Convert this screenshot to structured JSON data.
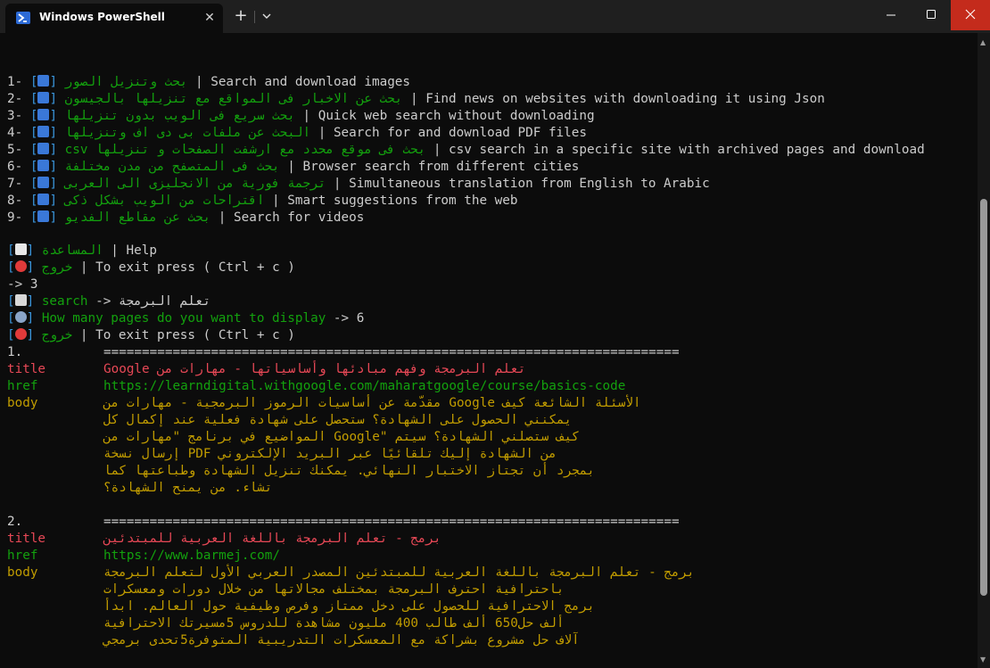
{
  "window": {
    "tab_title": "Windows PowerShell",
    "close_tab": "✕",
    "new_tab": "+"
  },
  "menu": [
    {
      "num": "1-",
      "ar": "بحث وتنزيل الصور",
      "en": "Search and download images"
    },
    {
      "num": "2-",
      "ar": "بحث عن الاخبار فى المواقع مع تنزيلها بالجيسون",
      "en": "Find news on websites with downloading it using Json"
    },
    {
      "num": "3-",
      "ar": "بحث سريع فى الويب بدون تنزيلها",
      "en": "Quick web search without downloading"
    },
    {
      "num": "4-",
      "ar": "البحث عن ملفات بى دى اف وتنزيلها",
      "en": "Search for and download PDF files"
    },
    {
      "num": "5-",
      "ar": "بحث فى موقع محدد مع ارشفت الصفحات و تنزيلها csv",
      "en": "csv search in a specific site with archived pages and download"
    },
    {
      "num": "6-",
      "ar": "بحث فى المتصفح من مدن مختلفة",
      "en": "Browser search from different cities"
    },
    {
      "num": "7-",
      "ar": "ترجمة فورية من الانجليزى الى العربى",
      "en": "Simultaneous translation from English to Arabic"
    },
    {
      "num": "8-",
      "ar": "اقتراحات من الويب بشكل ذكى",
      "en": "Smart suggestions from the web"
    },
    {
      "num": "9-",
      "ar": "بحث عن مقاطع الفديو",
      "en": "Search for videos"
    }
  ],
  "help": {
    "ar": "المساعدة",
    "en": "Help"
  },
  "exit": {
    "ar": "خروج",
    "en": "To exit press ( Ctrl + c )"
  },
  "choice": "-> 3",
  "search": {
    "label": "search",
    "arrow": "->",
    "query": "تعلم البرمجة"
  },
  "pages": {
    "prompt": "How many pages do you want to display",
    "value": "-> 6"
  },
  "results": [
    {
      "index": "1.",
      "separator": "===========================================================================",
      "title": "تعلم البرمجة وفهم مبادئها وأساسياتها - مهارات من Google",
      "href": "https://learndigital.withgoogle.com/maharatgoogle/course/basics-code",
      "body": [
        "الأسئلة الشائعة كيف Google مقدّمة عن أساسيات الرموز البرمجية - مهارات من",
        "يمكنني الحصول على الشهادة؟ ستحصل على شهادة فعلية عند إكمال كل",
        "كيف ستصلني الشهادة؟ سيتم \"Google المواضيع في برنامج \"مهارات من",
        "من الشهادة إليك تلقائيًا عبر البريد الإلكتروني PDF إرسال نسخة",
        "بمجرد أن تجتاز الاختبار النهائي. يمكنك تنزيل الشهادة وطباعتها كما",
        "تشاء. من يمنح الشهادة؟"
      ]
    },
    {
      "index": "2.",
      "separator": "===========================================================================",
      "title": "برمج - تعلم البرمجة باللغة العربية للمبتدئين",
      "href": "https://www.barmej.com/",
      "body": [
        "برمج - تعلم البرمجة باللغة العربية للمبتدئين المصدر العربي الأول لتعلم البرمجة",
        "باحترافية احترف البرمجة بمختلف مجالاتها من خلال دورات ومعسكرات",
        "برمج الاحترافية للحصول على دخل ممتاز وفرص وظيفية حول العالم. ابدأ",
        "ألف حل650 ألف طالب 400 مليون مشاهدة للدروس 5مسيرتك الاحترافية",
        "آلاف حل مشروع بشراكة مع المعسكرات التدريبية المتوفرة5تحدى برمجي"
      ]
    }
  ],
  "labels": {
    "title": "title",
    "href": "href",
    "body": "body"
  },
  "colors": {
    "green": "#13a10e",
    "blue": "#3a96dd",
    "red": "#e74856",
    "yellow": "#c19c00",
    "gray": "#cccccc",
    "close": "#c42b1c"
  },
  "icons": [
    "powershell-icon",
    "magnifier-icon",
    "dove-icon",
    "no-entry-icon",
    "robot-icon",
    "atom-icon",
    "chevron-down-icon",
    "minimize-icon",
    "maximize-icon",
    "close-icon"
  ]
}
